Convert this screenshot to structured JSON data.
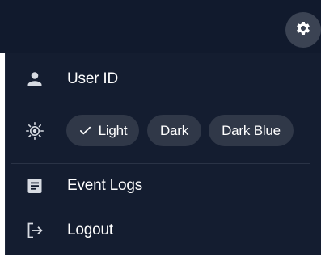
{
  "menu": {
    "user_label": "User ID",
    "theme": {
      "options": [
        "Light",
        "Dark",
        "Dark Blue"
      ],
      "selected": "Light"
    },
    "event_logs_label": "Event Logs",
    "logout_label": "Logout"
  },
  "icons": {
    "settings": "gear-icon",
    "user": "person-icon",
    "theme": "brightness-icon",
    "event_logs": "document-icon",
    "logout": "logout-icon",
    "check": "check-icon"
  },
  "colors": {
    "background": "#141d30",
    "header": "#111a2d",
    "chip": "#303848",
    "icon": "#d7dbe2",
    "text": "#ffffff"
  }
}
